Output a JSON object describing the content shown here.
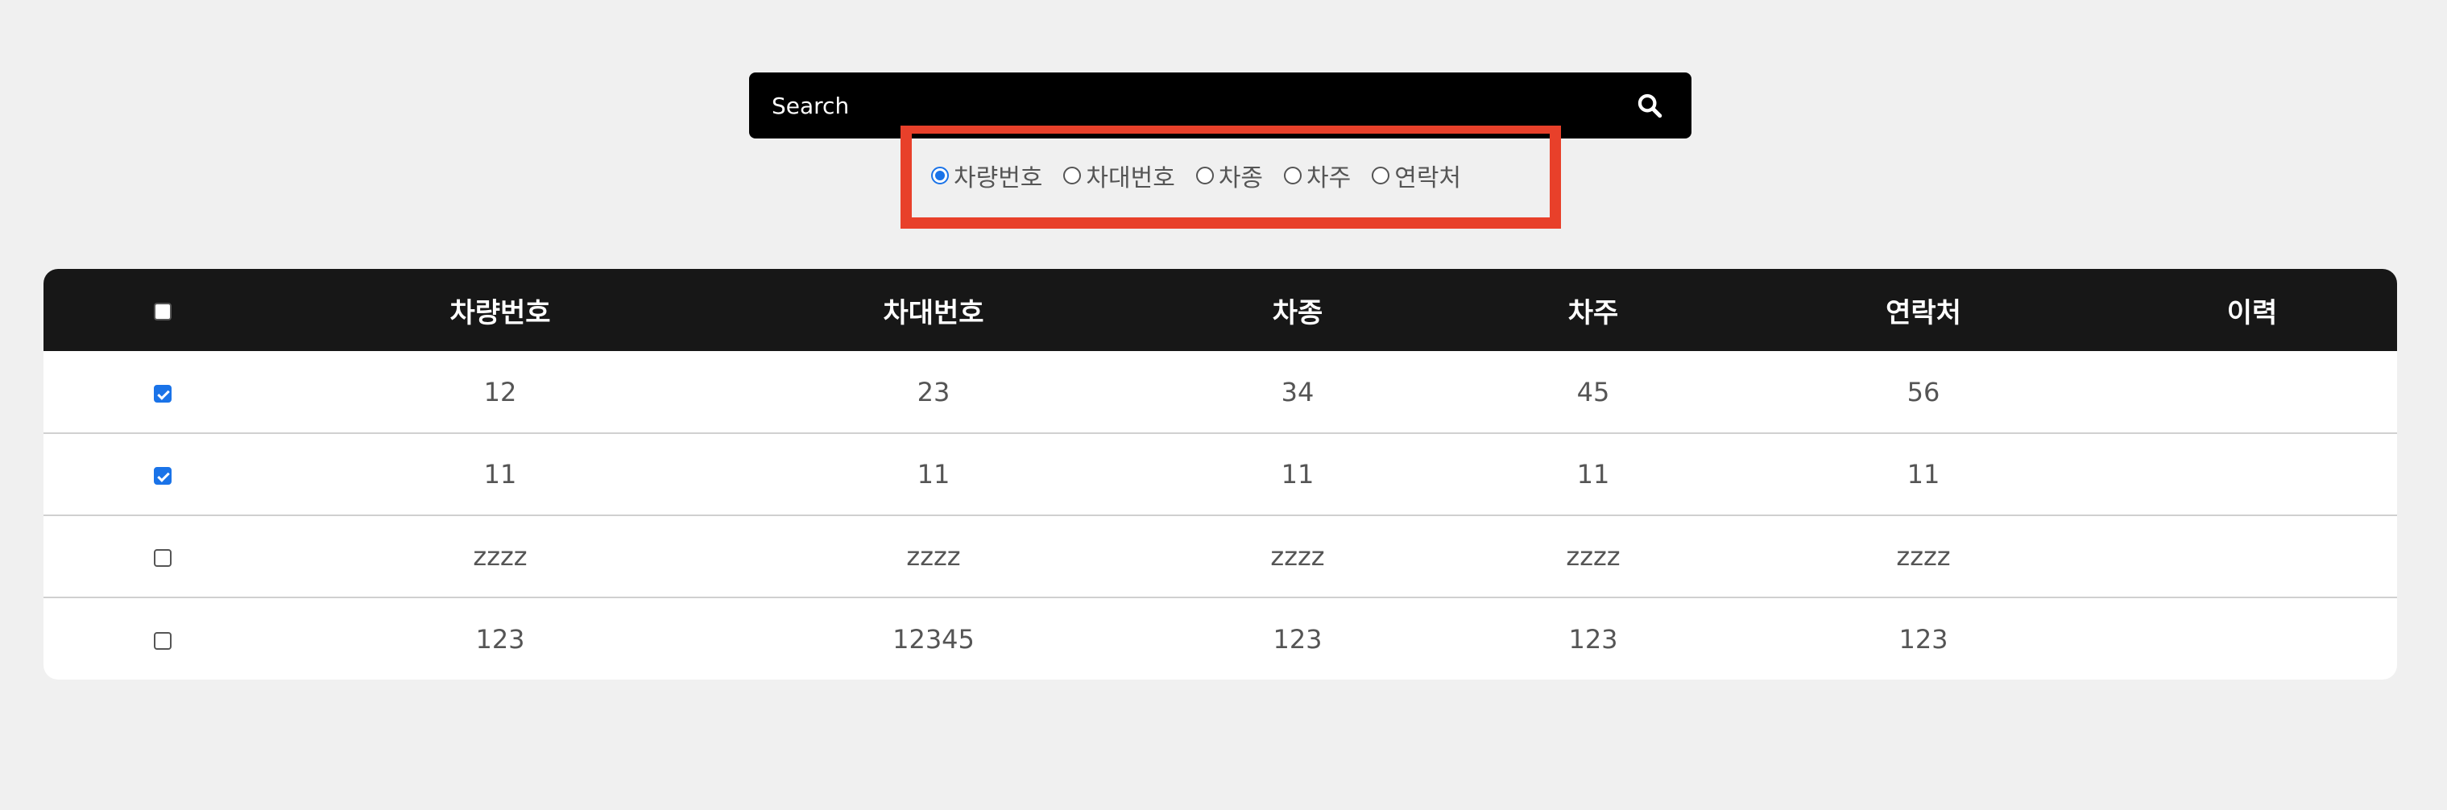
{
  "search": {
    "placeholder": "Search",
    "value": ""
  },
  "filter": {
    "options": [
      {
        "label": "차량번호",
        "checked": true
      },
      {
        "label": "차대번호",
        "checked": false
      },
      {
        "label": "차종",
        "checked": false
      },
      {
        "label": "차주",
        "checked": false
      },
      {
        "label": "연락처",
        "checked": false
      }
    ],
    "highlight_color": "#e8402a"
  },
  "table": {
    "headers": [
      "차량번호",
      "차대번호",
      "차종",
      "차주",
      "연락처",
      "이력"
    ],
    "header_checkbox_checked": false,
    "rows": [
      {
        "checked": true,
        "cells": [
          "12",
          "23",
          "34",
          "45",
          "56",
          ""
        ]
      },
      {
        "checked": true,
        "cells": [
          "11",
          "11",
          "11",
          "11",
          "11",
          ""
        ]
      },
      {
        "checked": false,
        "cells": [
          "zzzz",
          "zzzz",
          "zzzz",
          "zzzz",
          "zzzz",
          ""
        ]
      },
      {
        "checked": false,
        "cells": [
          "123",
          "12345",
          "123",
          "123",
          "123",
          ""
        ]
      }
    ]
  },
  "colors": {
    "accent": "#1a73e8",
    "header_bg": "#171717",
    "search_bg": "#000000"
  },
  "icons": {
    "search": "search-icon"
  }
}
